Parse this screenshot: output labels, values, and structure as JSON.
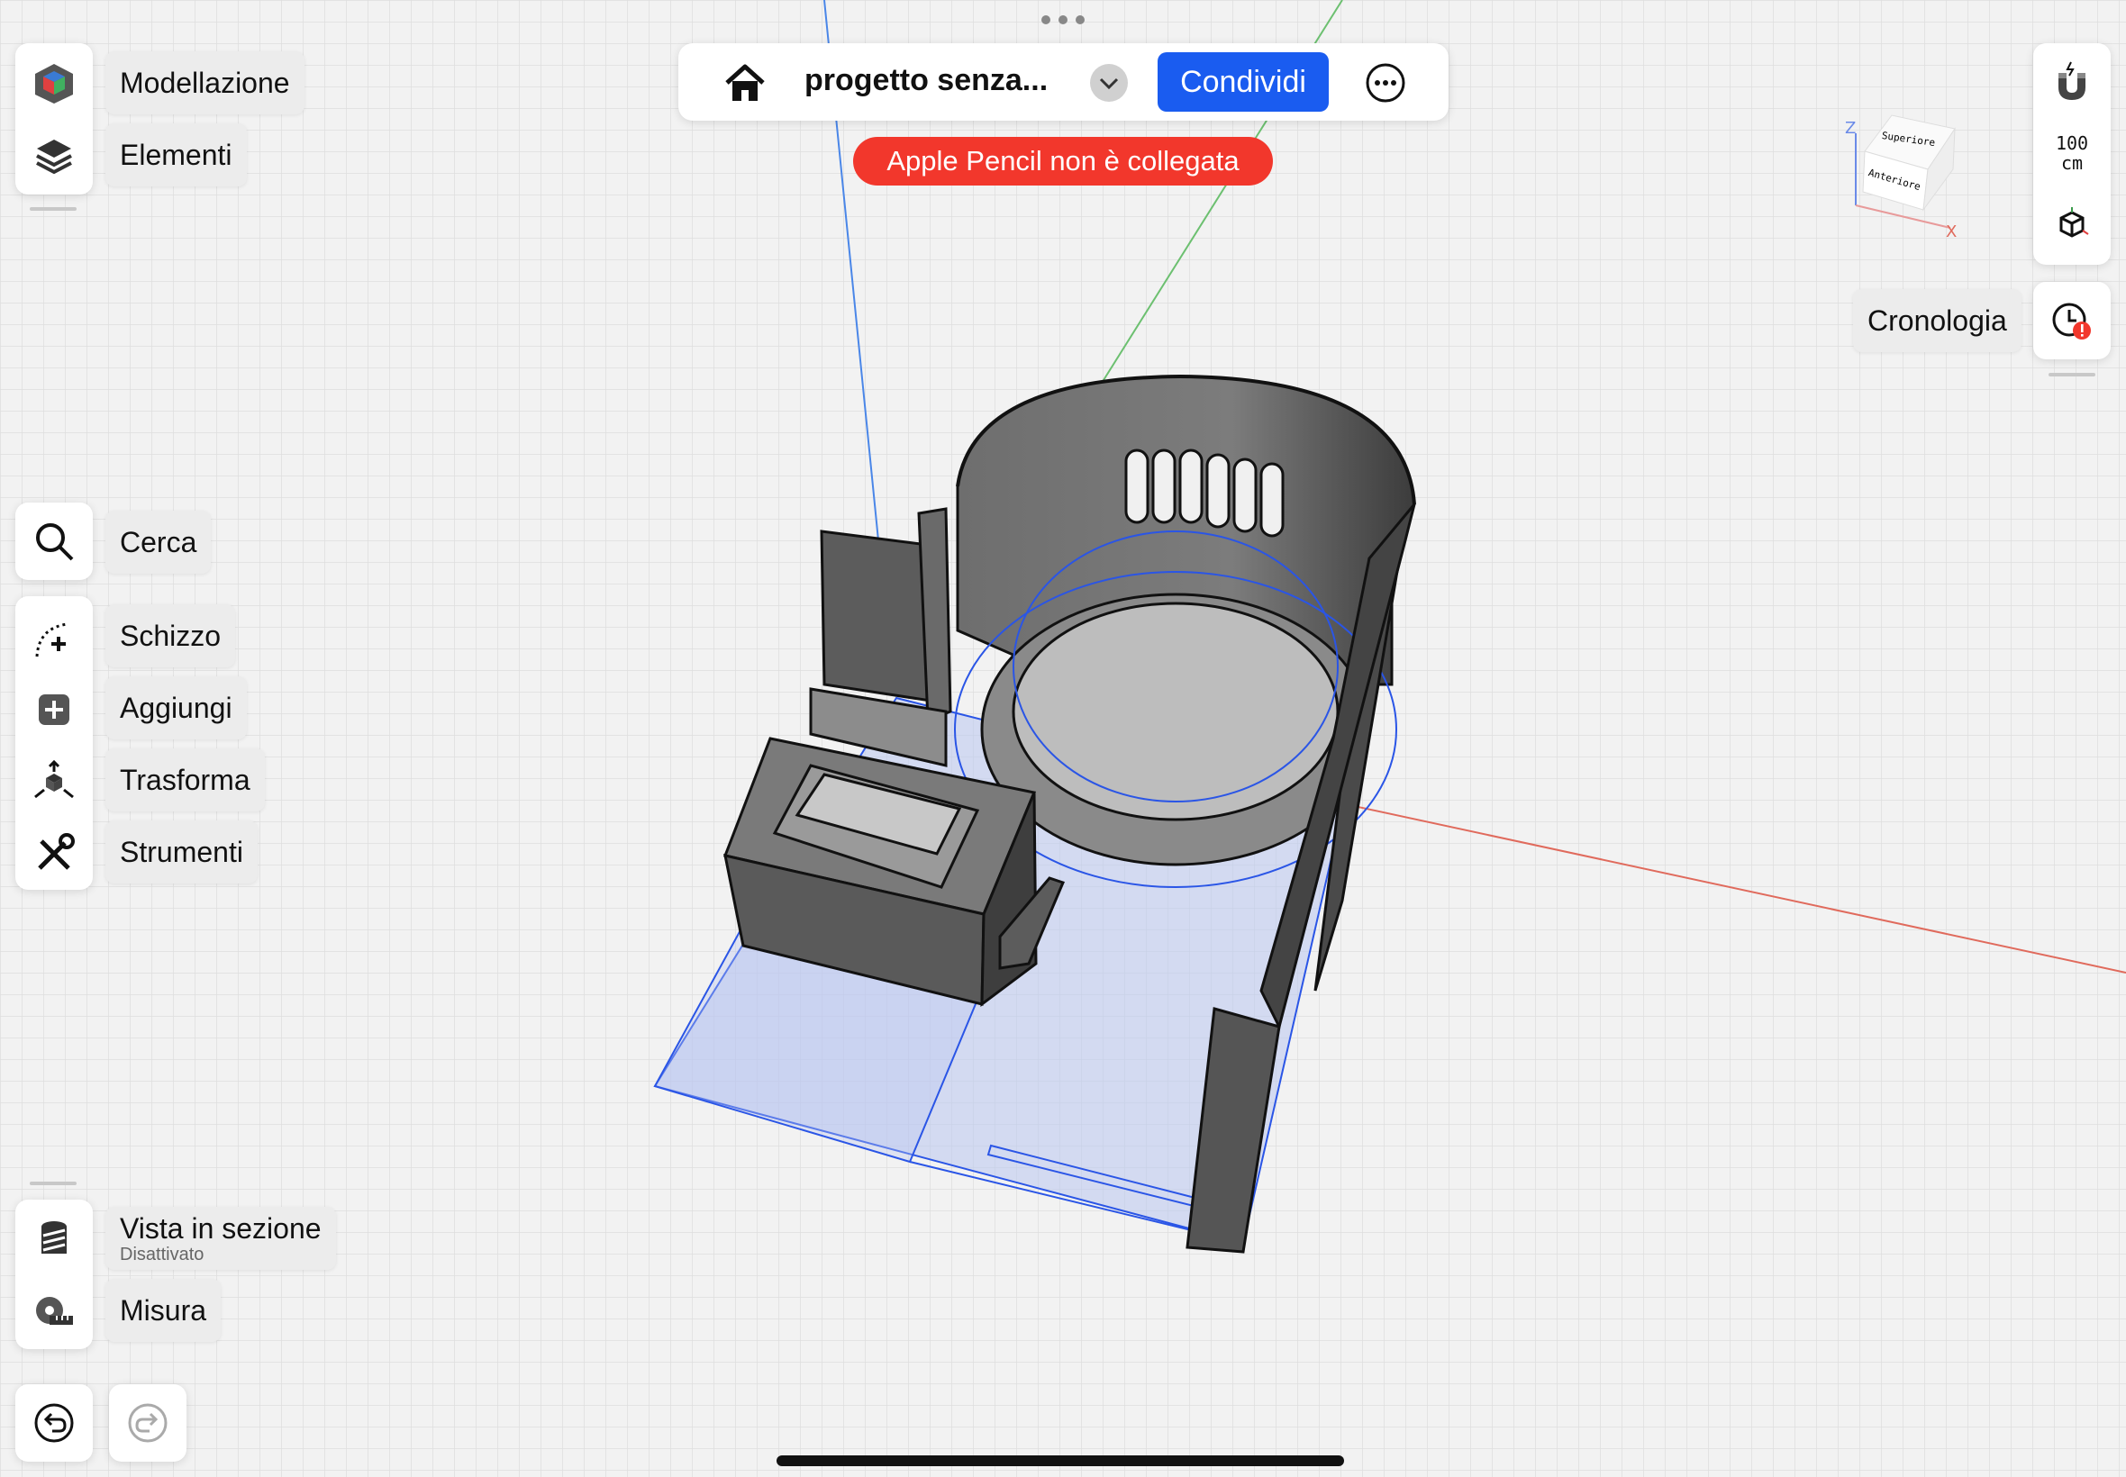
{
  "topbar": {
    "title": "progetto senza...",
    "share_label": "Condividi",
    "alert": "Apple Pencil non è collegata"
  },
  "left_top": {
    "modeling_label": "Modellazione",
    "elements_label": "Elementi"
  },
  "left_tools": {
    "search_label": "Cerca",
    "sketch_label": "Schizzo",
    "add_label": "Aggiungi",
    "transform_label": "Trasforma",
    "tools_label": "Strumenti"
  },
  "left_bottom": {
    "section_label": "Vista in sezione",
    "section_status": "Disattivato",
    "measure_label": "Misura"
  },
  "right": {
    "scale_value": "100",
    "scale_unit": "cm",
    "history_label": "Cronologia",
    "cube_top": "Superiore",
    "cube_front": "Anteriore",
    "axis_z": "Z",
    "axis_x": "X"
  },
  "icons": {
    "home": "home-icon",
    "dropdown": "chevron-down-icon",
    "more": "more-icon",
    "magnet": "magnet-icon",
    "history": "history-icon"
  },
  "colors": {
    "accent": "#1a5cf0",
    "alert": "#f2372c",
    "selection": "#2a55e6",
    "wall": "#5a5a5a"
  }
}
